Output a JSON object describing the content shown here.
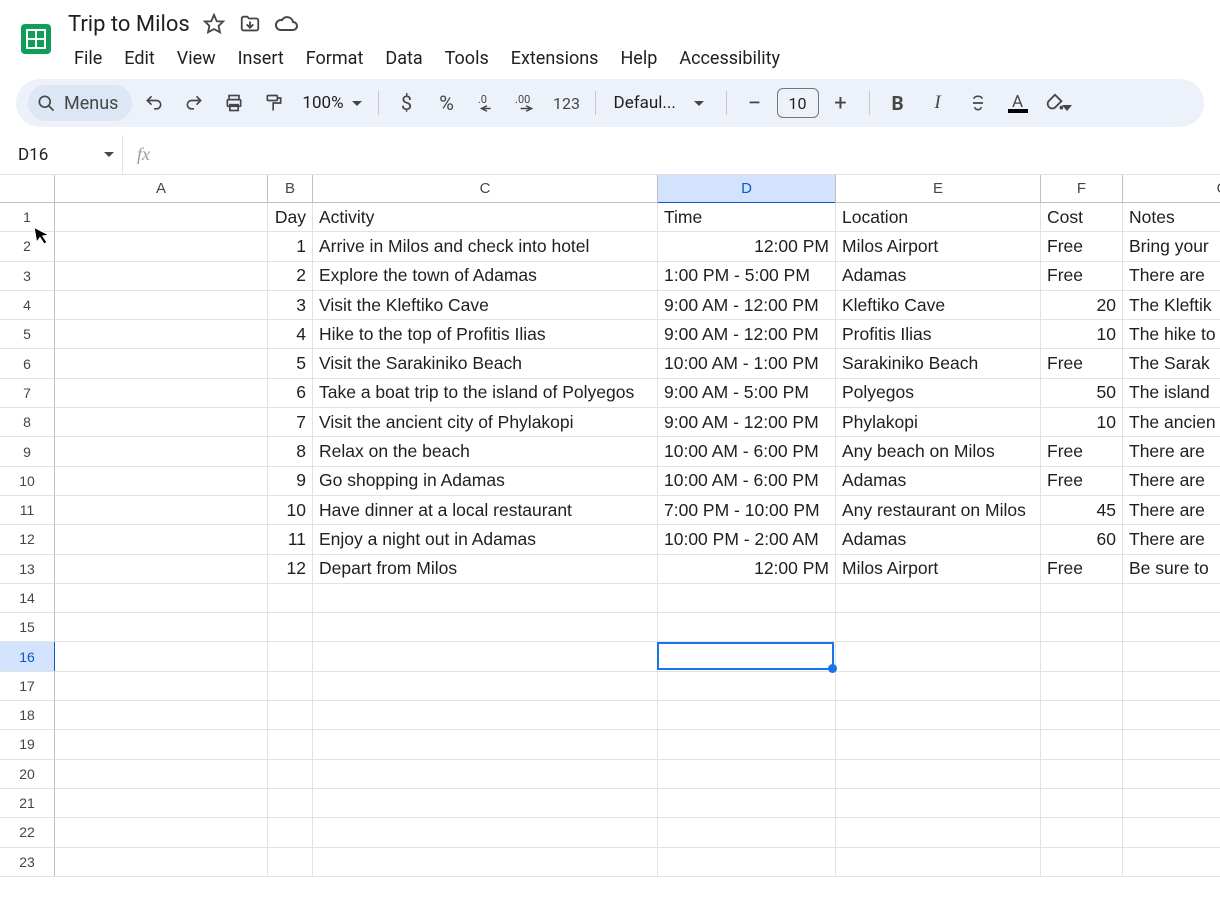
{
  "doc": {
    "title": "Trip to Milos"
  },
  "menus": {
    "pill_label": "Menus",
    "items": [
      "File",
      "Edit",
      "View",
      "Insert",
      "Format",
      "Data",
      "Tools",
      "Extensions",
      "Help",
      "Accessibility"
    ]
  },
  "toolbar": {
    "zoom": "100%",
    "font": "Defaul...",
    "font_size": "10"
  },
  "namebox": {
    "ref": "D16"
  },
  "columns": [
    "A",
    "B",
    "C",
    "D",
    "E",
    "F",
    "G"
  ],
  "selected_col_index": 3,
  "selected_row": 16,
  "total_rows": 23,
  "headers": {
    "B": "Day",
    "C": "Activity",
    "D": "Time",
    "E": "Location",
    "F": "Cost",
    "G": "Notes"
  },
  "data_rows": [
    {
      "B": "1",
      "C": "Arrive in Milos and check into hotel",
      "D": "12:00 PM",
      "D_align": "right",
      "E": "Milos Airport",
      "F": "Free",
      "F_align": "left",
      "G": "Bring your"
    },
    {
      "B": "2",
      "C": "Explore the town of Adamas",
      "D": "1:00 PM - 5:00 PM",
      "E": "Adamas",
      "F": "Free",
      "F_align": "left",
      "G": "There are"
    },
    {
      "B": "3",
      "C": "Visit the Kleftiko Cave",
      "D": "9:00 AM - 12:00 PM",
      "E": "Kleftiko Cave",
      "F": "20",
      "F_align": "right",
      "G": "The Kleftik"
    },
    {
      "B": "4",
      "C": "Hike to the top of Profitis Ilias",
      "D": "9:00 AM - 12:00 PM",
      "E": "Profitis Ilias",
      "F": "10",
      "F_align": "right",
      "G": "The hike to"
    },
    {
      "B": "5",
      "C": "Visit the Sarakiniko Beach",
      "D": "10:00 AM - 1:00 PM",
      "E": "Sarakiniko Beach",
      "F": "Free",
      "F_align": "left",
      "G": "The Sarak"
    },
    {
      "B": "6",
      "C": "Take a boat trip to the island of Polyegos",
      "D": "9:00 AM - 5:00 PM",
      "E": "Polyegos",
      "F": "50",
      "F_align": "right",
      "G": "The island"
    },
    {
      "B": "7",
      "C": "Visit the ancient city of Phylakopi",
      "D": "9:00 AM - 12:00 PM",
      "E": "Phylakopi",
      "F": "10",
      "F_align": "right",
      "G": "The ancien"
    },
    {
      "B": "8",
      "C": "Relax on the beach",
      "D": "10:00 AM - 6:00 PM",
      "E": "Any beach on Milos",
      "F": "Free",
      "F_align": "left",
      "G": "There are"
    },
    {
      "B": "9",
      "C": "Go shopping in Adamas",
      "D": "10:00 AM - 6:00 PM",
      "E": "Adamas",
      "F": "Free",
      "F_align": "left",
      "G": "There are"
    },
    {
      "B": "10",
      "C": "Have dinner at a local restaurant",
      "D": "7:00 PM - 10:00 PM",
      "E": "Any restaurant on Milos",
      "F": "45",
      "F_align": "right",
      "G": "There are"
    },
    {
      "B": "11",
      "C": "Enjoy a night out in Adamas",
      "D": "10:00 PM - 2:00 AM",
      "E": "Adamas",
      "F": "60",
      "F_align": "right",
      "G": "There are"
    },
    {
      "B": "12",
      "C": "Depart from Milos",
      "D": "12:00 PM",
      "D_align": "right",
      "E": "Milos Airport",
      "F": "Free",
      "F_align": "left",
      "G": "Be sure to"
    }
  ]
}
